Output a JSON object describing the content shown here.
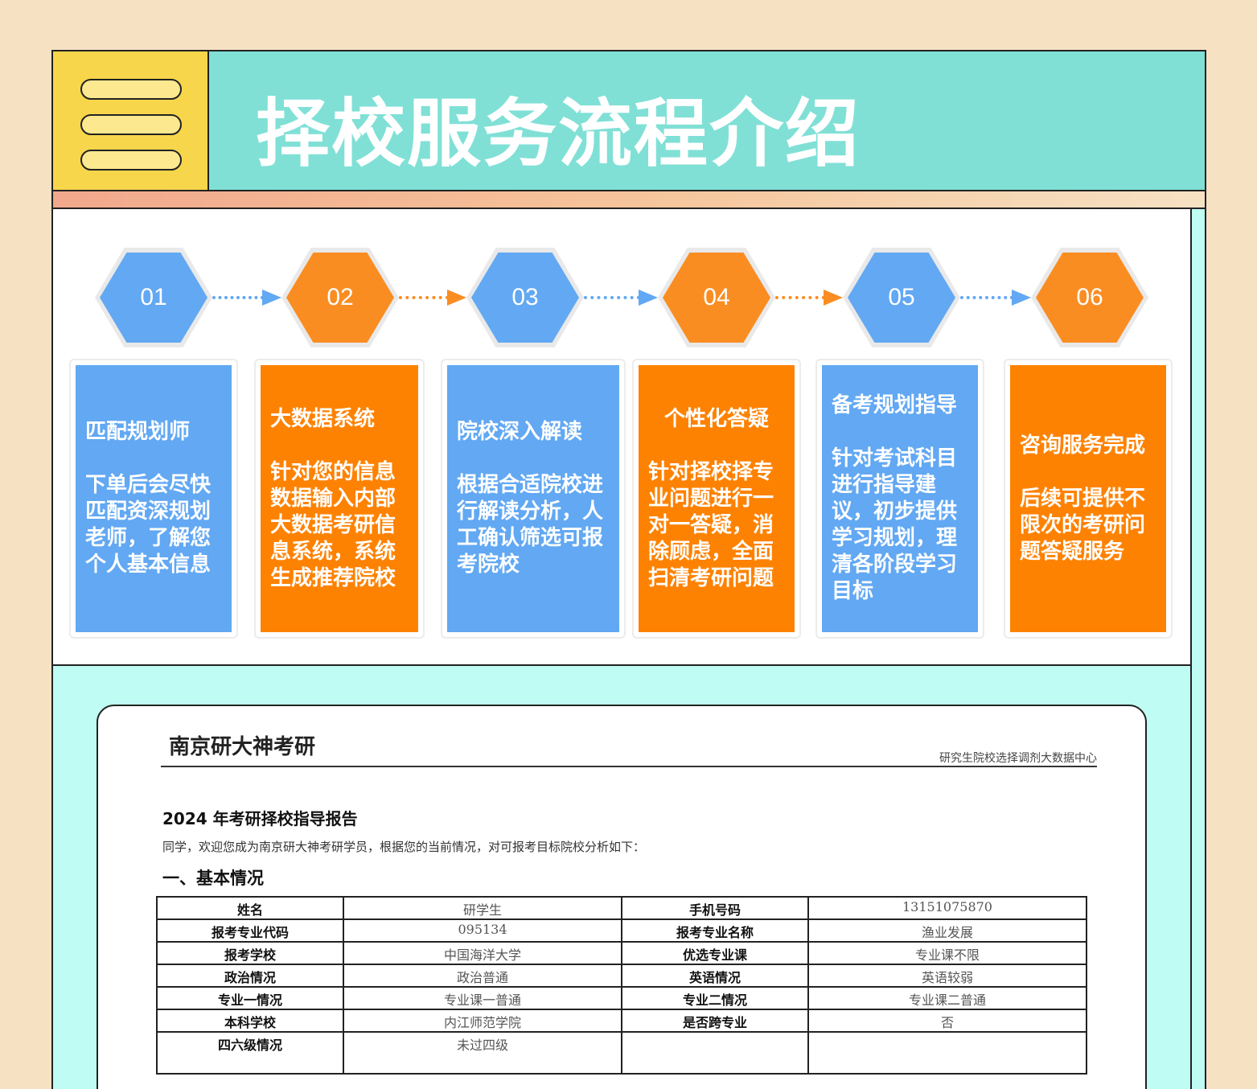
{
  "header": {
    "title": "择校服务流程介绍",
    "menu_icon": "hamburger-menu-icon"
  },
  "colors": {
    "header_bg": "#80e0d6",
    "menu_bg": "#f7d64b",
    "blue": "#62a8f3",
    "orange": "#fa8d22",
    "page_bg": "#f6e1c3",
    "lower_bg": "#bffcf3"
  },
  "steps": [
    {
      "num": "01",
      "title": "匹配规划师",
      "body": "下单后会尽快\n匹配资深规划\n老师，了解您\n个人基本信息",
      "color": "blue"
    },
    {
      "num": "02",
      "title": "大数据系统",
      "body": "针对您的信息\n数据输入内部\n大数据考研信\n息系统，系统\n生成推荐院校",
      "color": "orange"
    },
    {
      "num": "03",
      "title": "院校深入解读",
      "body": "根据合适院校进\n行解读分析，人\n工确认筛选可报\n考院校",
      "color": "blue"
    },
    {
      "num": "04",
      "title": "个性化答疑",
      "body": "针对择校择专\n业问题进行一\n对一答疑，消\n除顾虑，全面\n扫清考研问题",
      "color": "orange"
    },
    {
      "num": "05",
      "title": "备考规划指导",
      "body": "针对考试科目\n进行指导建\n议，初步提供\n学习规划，理\n清各阶段学习\n目标",
      "color": "blue"
    },
    {
      "num": "06",
      "title": "咨询服务完成",
      "body": "后续可提供不\n限次的考研问\n题答疑服务",
      "color": "orange"
    }
  ],
  "report": {
    "brand": "南京研大神考研",
    "center": "研究生院校选择调剂大数据中心",
    "title": "2024 年考研择校指导报告",
    "intro": "同学，欢迎您成为南京研大神考研学员，根据您的当前情况，对可报考目标院校分析如下：",
    "section": "一、基本情况",
    "rows": [
      [
        "姓名",
        "研学生",
        "手机号码",
        "13151075870"
      ],
      [
        "报考专业代码",
        "095134",
        "报考专业名称",
        "渔业发展"
      ],
      [
        "报考学校",
        "中国海洋大学",
        "优选专业课",
        "专业课不限"
      ],
      [
        "政治情况",
        "政治普通",
        "英语情况",
        "英语较弱"
      ],
      [
        "专业一情况",
        "专业课一普通",
        "专业二情况",
        "专业课二普通"
      ],
      [
        "本科学校",
        "内江师范学院",
        "是否跨专业",
        "否"
      ],
      [
        "四六级情况",
        "未过四级",
        "",
        ""
      ]
    ]
  }
}
